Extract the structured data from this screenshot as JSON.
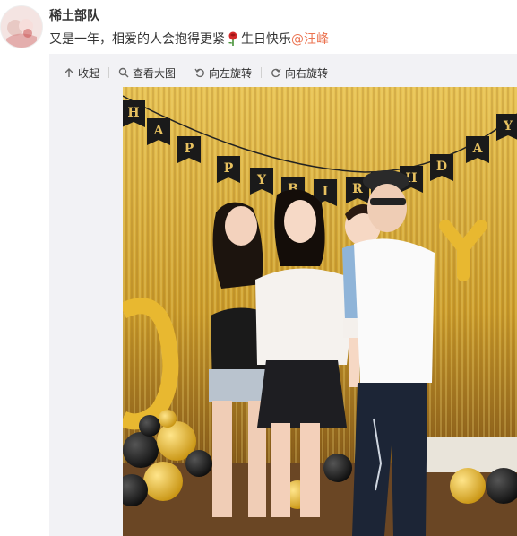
{
  "user": {
    "name": "稀土部队"
  },
  "post": {
    "text_before": "又是一年，相爱的人会抱得更紧",
    "emoji": "rose-icon",
    "text_after": "生日快乐",
    "mention": "@汪峰"
  },
  "toolbar": {
    "collapse_label": "收起",
    "view_large_label": "查看大图",
    "rotate_left_label": "向左旋转",
    "rotate_right_label": "向右旋转"
  },
  "photo": {
    "banner_letters": [
      "H",
      "A",
      "P",
      "P",
      "Y",
      "B",
      "I",
      "R",
      "T",
      "H",
      "D",
      "A",
      "Y"
    ]
  },
  "colors": {
    "mention": "#eb7350",
    "media_bg": "#f2f2f5",
    "gold": "#d4a92a",
    "banner": "#1a1a1a"
  }
}
